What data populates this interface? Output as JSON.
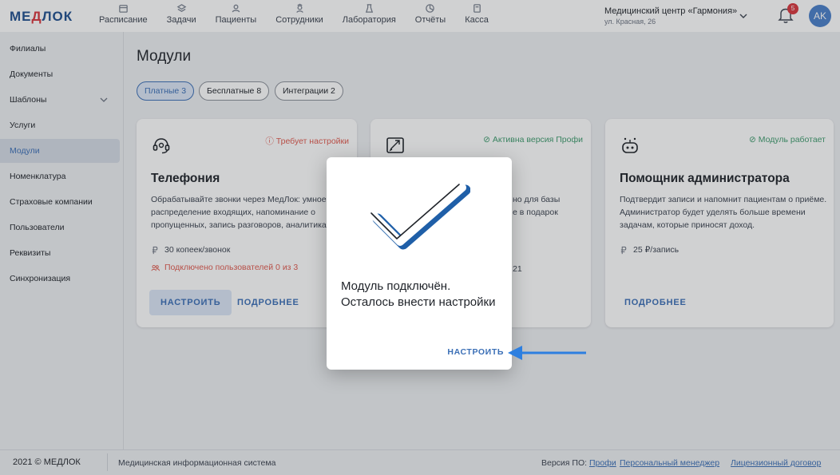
{
  "header": {
    "logo": "МЕДЛОК",
    "nav": [
      {
        "label": "Расписание",
        "icon": "calendar-icon"
      },
      {
        "label": "Задачи",
        "icon": "layers-icon"
      },
      {
        "label": "Пациенты",
        "icon": "user-icon"
      },
      {
        "label": "Сотрудники",
        "icon": "staff-icon"
      },
      {
        "label": "Лаборатория",
        "icon": "flask-icon"
      },
      {
        "label": "Отчёты",
        "icon": "chart-pie-icon"
      },
      {
        "label": "Касса",
        "icon": "cashbox-icon"
      }
    ],
    "clinic_name": "Медицинский центр «Гармония»",
    "clinic_address": "ул. Красная, 26",
    "notifications_count": "5",
    "avatar_initials": "AK"
  },
  "sidebar": {
    "items": [
      {
        "label": "Филиалы"
      },
      {
        "label": "Документы"
      },
      {
        "label": "Шаблоны"
      },
      {
        "label": "Услуги"
      },
      {
        "label": "Модули"
      },
      {
        "label": "Номенклатура"
      },
      {
        "label": "Страховые компании"
      },
      {
        "label": "Пользователи"
      },
      {
        "label": "Реквизиты"
      },
      {
        "label": "Синхронизация"
      }
    ],
    "active_index": 4
  },
  "main": {
    "title": "Модули",
    "tabs": [
      {
        "label": "Платные 3"
      },
      {
        "label": "Бесплатные 8"
      },
      {
        "label": "Интеграции 2"
      }
    ],
    "cards": [
      {
        "status": "Требует настройки",
        "title": "Телефония",
        "description": "Обрабатывайте звонки через МедЛок: умное распределение входящих, напоминание о пропущенных, запись разговоров, аналитика",
        "price": "30 копеек/звонок",
        "users": "Подключено пользователей 0 из 3",
        "primary_button": "НАСТРОИТЬ",
        "secondary_button": "ПОДРОБНЕЕ"
      },
      {
        "status": "Активна версия Профи",
        "description": "но для базы\nе в подарок",
        "extra": "21"
      },
      {
        "status": "Модуль работает",
        "title": "Помощник администратора",
        "description": "Подтвердит записи и напомнит пациентам о приёме. Администратор будет уделять больше времени задачам, которые приносят доход.",
        "price": "25 ₽/запись",
        "secondary_button": "ПОДРОБНЕЕ"
      }
    ]
  },
  "modal": {
    "message": "Модуль подключён. Осталось внести настройки",
    "button": "НАСТРОИТЬ"
  },
  "footer": {
    "copyright": "2021 © МЕДЛОК",
    "system": "Медицинская информационная система",
    "version_label": "Версия ПО:",
    "version_link": "Профи",
    "manager_link": "Персональный менеджер",
    "license_link": "Лицензионный договор"
  },
  "colors": {
    "accent": "#3b6fb6",
    "warning": "#e05a4f",
    "success": "#3f9b6e",
    "arrow": "#2d7fe0"
  }
}
